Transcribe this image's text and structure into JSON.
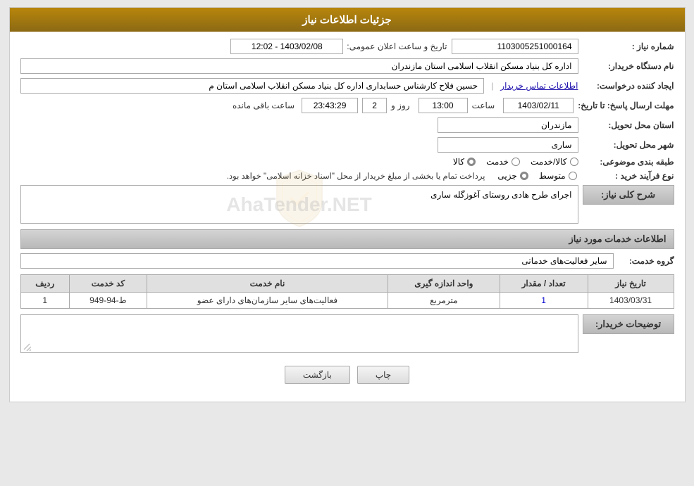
{
  "header": {
    "title": "جزئیات اطلاعات نیاز"
  },
  "fields": {
    "shomara_niyaz_label": "شماره نیاز :",
    "shomara_niyaz_value": "1103005251000164",
    "tarikh_label": "تاریخ و ساعت اعلان عمومی:",
    "tarikh_value": "1403/02/08 - 12:02",
    "naam_dastgah_label": "نام دستگاه خریدار:",
    "naam_dastgah_value": "اداره کل بنیاد مسکن انقلاب اسلامی استان مازندران",
    "ijad_label": "ایجاد کننده درخواست:",
    "ijad_value": "حسین فلاح کارشناس حسابداری اداره کل بنیاد مسکن انقلاب اسلامی استان م",
    "ijad_link": "اطلاعات تماس خریدار",
    "mohlat_label": "مهلت ارسال پاسخ: تا تاریخ:",
    "date_box": "1403/02/11",
    "saat_label": "ساعت",
    "saat_value": "13:00",
    "rooz_label": "روز و",
    "rooz_value": "2",
    "mande_label": "ساعت باقی مانده",
    "mande_value": "23:43:29",
    "ostan_label": "استان محل تحویل:",
    "ostan_value": "مازندران",
    "shahr_label": "شهر محل تحویل:",
    "shahr_value": "ساری",
    "tabaqe_label": "طبقه بندی موضوعی:",
    "radio_kala": "کالا",
    "radio_khedmat": "خدمت",
    "radio_kala_khedmat": "کالا/خدمت",
    "process_label": "نوع فرآیند خرید :",
    "process_radio_jozi": "جزیی",
    "process_radio_motavaset": "متوسط",
    "process_notice": "پرداخت تمام یا بخشی از مبلغ خریدار از محل \"اسناد خزانه اسلامی\" خواهد بود.",
    "sharh_label": "شرح کلی نیاز:",
    "sharh_value": "اجرای طرح هادی روستای آغوزگله ساری",
    "khadamat_header": "اطلاعات خدمات مورد نیاز",
    "goroh_label": "گروه خدمت:",
    "goroh_value": "سایر فعالیت‌های خدماتی",
    "table": {
      "headers": [
        "ردیف",
        "کد خدمت",
        "نام خدمت",
        "واحد اندازه گیری",
        "تعداد / مقدار",
        "تاریخ نیاز"
      ],
      "rows": [
        {
          "radif": "1",
          "kod": "ط-94-949",
          "naam": "فعالیت‌های سایر سازمان‌های دارای عضو",
          "vahed": "مترمربع",
          "tedad": "1",
          "tarikh": "1403/03/31"
        }
      ]
    },
    "tawzih_label": "توضیحات خریدار:",
    "btn_chap": "چاپ",
    "btn_bazgasht": "بازگشت"
  }
}
